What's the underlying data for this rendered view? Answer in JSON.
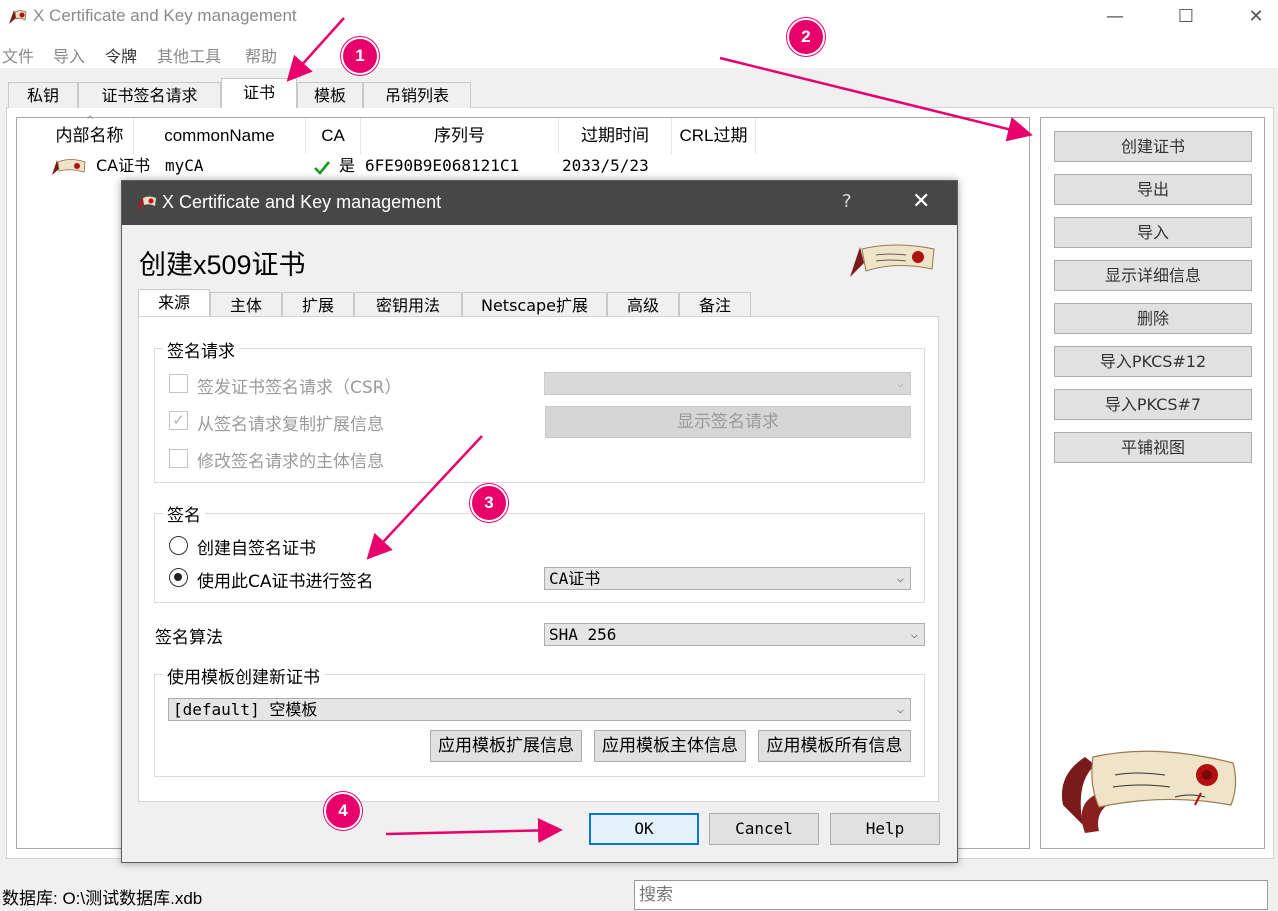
{
  "window": {
    "title": "X Certificate and Key management"
  },
  "menu": {
    "items": [
      "文件",
      "导入",
      "令牌",
      "其他工具",
      "帮助"
    ]
  },
  "main_tabs": [
    "私钥",
    "证书签名请求",
    "证书",
    "模板",
    "吊销列表"
  ],
  "table": {
    "columns": [
      "内部名称",
      "commonName",
      "CA",
      "序列号",
      "过期时间",
      "CRL过期"
    ],
    "rows": [
      {
        "internal_name": "CA证书",
        "common_name": "myCA",
        "ca": "是",
        "serial": "6FE90B9E068121C1",
        "expiry": "2033/5/23",
        "crl_expiry": ""
      }
    ]
  },
  "side_buttons": [
    "创建证书",
    "导出",
    "导入",
    "显示详细信息",
    "删除",
    "导入PKCS#12",
    "导入PKCS#7",
    "平铺视图"
  ],
  "status": {
    "database": "数据库: O:\\测试数据库.xdb",
    "search_placeholder": "搜索"
  },
  "dialog": {
    "title": "X Certificate and Key management",
    "help": "?",
    "heading": "创建x509证书",
    "tabs": [
      "来源",
      "主体",
      "扩展",
      "密钥用法",
      "Netscape扩展",
      "高级",
      "备注"
    ],
    "sign_request": {
      "title": "签名请求",
      "issue_csr": "签发证书签名请求（CSR）",
      "copy_ext": "从签名请求复制扩展信息",
      "modify_subject": "修改签名请求的主体信息",
      "show_request": "显示签名请求"
    },
    "signing": {
      "title": "签名",
      "self_signed": "创建自签名证书",
      "use_ca": "使用此CA证书进行签名",
      "ca_value": "CA证书"
    },
    "algorithm": {
      "label": "签名算法",
      "value": "SHA 256"
    },
    "template": {
      "title": "使用模板创建新证书",
      "value": "[default] 空模板",
      "apply_ext": "应用模板扩展信息",
      "apply_subject": "应用模板主体信息",
      "apply_all": "应用模板所有信息"
    },
    "buttons": {
      "ok": "OK",
      "cancel": "Cancel",
      "help": "Help"
    }
  },
  "markers": [
    "1",
    "2",
    "3",
    "4"
  ],
  "colors": {
    "accent": "#e8006b",
    "dialog_title": "#474747",
    "default_button": "#0078d7"
  }
}
